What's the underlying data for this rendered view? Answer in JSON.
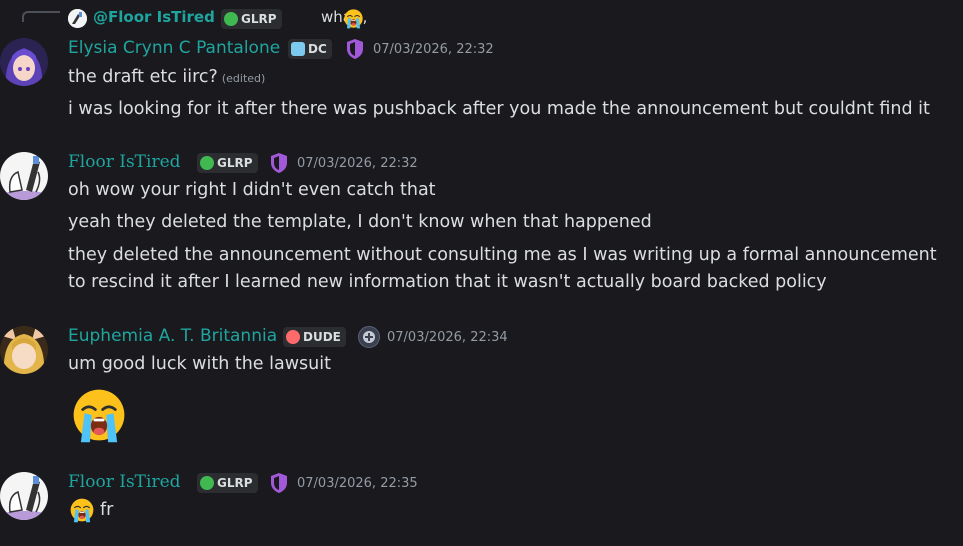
{
  "reply": {
    "username": "@Floor IsTired",
    "tag": "GLRP",
    "text": "what,,",
    "emoji_icon": "loudly-crying-emoji"
  },
  "messages": [
    {
      "username": "Elysia Crynn C Pantalone",
      "tag": "DC",
      "tag_icon": "heart-icon",
      "role_icon": "shield-icon",
      "timestamp": "07/03/2026, 22:32",
      "lines": [
        "the draft etc iirc?",
        "i was looking for it after there was pushback after you made the announcement but couldnt find it"
      ],
      "edited_label": "(edited)"
    },
    {
      "username": "Floor IsTired",
      "tag": "GLRP",
      "tag_icon": "skull-icon",
      "role_icon": "shield-icon",
      "timestamp": "07/03/2026, 22:32",
      "lines": [
        "oh wow your right I didn't even catch that",
        "yeah they deleted the template, I don't know when that happened",
        "they deleted the announcement without consulting me as I was writing up a formal announcement to rescind it after I learned new information that it wasn't actually board backed policy"
      ]
    },
    {
      "username": "Euphemia A. T. Britannia",
      "tag": "DUDE",
      "tag_icon": "skull-icon",
      "role_icon": "plus-icon",
      "timestamp": "07/03/2026, 22:34",
      "lines": [
        "um good luck with the lawsuit"
      ],
      "emoji_icon": "loudly-crying-emoji"
    },
    {
      "username": "Floor IsTired",
      "tag": "GLRP",
      "tag_icon": "skull-icon",
      "role_icon": "shield-icon",
      "timestamp": "07/03/2026, 22:35",
      "lines": [
        "fr"
      ],
      "emoji_icon": "loudly-crying-emoji"
    }
  ],
  "colors": {
    "background": "#1a1a1e",
    "username": "#1fa5a0",
    "text": "#dbdee1",
    "timestamp": "#949ba4",
    "shield": "#a259d9"
  }
}
